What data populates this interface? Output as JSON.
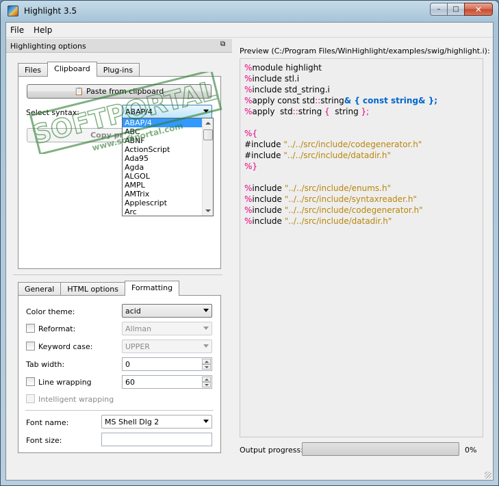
{
  "window": {
    "title": "Highlight 3.5"
  },
  "menu": {
    "file": "File",
    "help": "Help"
  },
  "options_dock": {
    "title": "Highlighting options"
  },
  "top_tabs": [
    {
      "label": "Files",
      "active": false
    },
    {
      "label": "Clipboard",
      "active": true
    },
    {
      "label": "Plug-ins",
      "active": false
    }
  ],
  "clipboard": {
    "paste_button": "Paste from clipboard",
    "syntax_label": "Select syntax:",
    "syntax_value": "ABAP/4",
    "copy_button": "Copy preview"
  },
  "syntax_list": [
    "ABAP/4",
    "ABC",
    "ABNF",
    "ActionScript",
    "Ada95",
    "Agda",
    "ALGOL",
    "AMPL",
    "AMTrix",
    "Applescript",
    "Arc"
  ],
  "bottom_tabs": [
    {
      "label": "General",
      "active": false
    },
    {
      "label": "HTML options",
      "active": false
    },
    {
      "label": "Formatting",
      "active": true
    }
  ],
  "formatting": {
    "color_theme_label": "Color theme:",
    "color_theme_value": "acid",
    "reformat_label": "Reformat:",
    "reformat_value": "Allman",
    "keyword_case_label": "Keyword case:",
    "keyword_case_value": "UPPER",
    "tab_width_label": "Tab width:",
    "tab_width_value": "0",
    "line_wrapping_label": "Line wrapping",
    "line_wrapping_value": "60",
    "intelligent_wrapping_label": "Intelligent wrapping",
    "font_name_label": "Font name:",
    "font_name_value": "MS Shell Dlg 2",
    "font_size_label": "Font size:"
  },
  "preview": {
    "label": "Preview (C:/Program Files/WinHighlight/examples/swig/highlight.i):",
    "lines": [
      [
        [
          "%",
          "pink"
        ],
        [
          "module highlight",
          ""
        ]
      ],
      [
        [
          "%",
          "pink"
        ],
        [
          "include stl.i",
          ""
        ]
      ],
      [
        [
          "%",
          "pink"
        ],
        [
          "include std_string.i",
          ""
        ]
      ],
      [
        [
          "%",
          "pink"
        ],
        [
          "apply const std",
          ""
        ],
        [
          "::",
          "pink"
        ],
        [
          "string",
          ""
        ],
        [
          "& { const string& };",
          "blue"
        ]
      ],
      [
        [
          "%",
          "pink"
        ],
        [
          "apply  std",
          ""
        ],
        [
          "::",
          "pink"
        ],
        [
          "string",
          ""
        ],
        [
          " {",
          "pink"
        ],
        [
          "  string ",
          ""
        ],
        [
          "};",
          "pink"
        ]
      ],
      [],
      [
        [
          "%{",
          "pink"
        ]
      ],
      [
        [
          "#include ",
          ""
        ],
        [
          "\"../../src/include/codegenerator.h\"",
          "gold"
        ]
      ],
      [
        [
          "#include ",
          ""
        ],
        [
          "\"../../src/include/datadir.h\"",
          "gold"
        ]
      ],
      [
        [
          "%}",
          "pink"
        ]
      ],
      [],
      [
        [
          "%",
          "pink"
        ],
        [
          "include ",
          ""
        ],
        [
          "\"../../src/include/enums.h\"",
          "gold"
        ]
      ],
      [
        [
          "%",
          "pink"
        ],
        [
          "include ",
          ""
        ],
        [
          "\"../../src/include/syntaxreader.h\"",
          "gold"
        ]
      ],
      [
        [
          "%",
          "pink"
        ],
        [
          "include ",
          ""
        ],
        [
          "\"../../src/include/codegenerator.h\"",
          "gold"
        ]
      ],
      [
        [
          "%",
          "pink"
        ],
        [
          "include ",
          ""
        ],
        [
          "\"../../src/include/datadir.h\"",
          "gold"
        ]
      ]
    ]
  },
  "progress": {
    "label": "Output progress:",
    "value": 0,
    "percent_text": "0%"
  },
  "watermark": {
    "text": "SOFTPORTAL",
    "url": "www.softportal.com",
    "tm": "TM"
  }
}
